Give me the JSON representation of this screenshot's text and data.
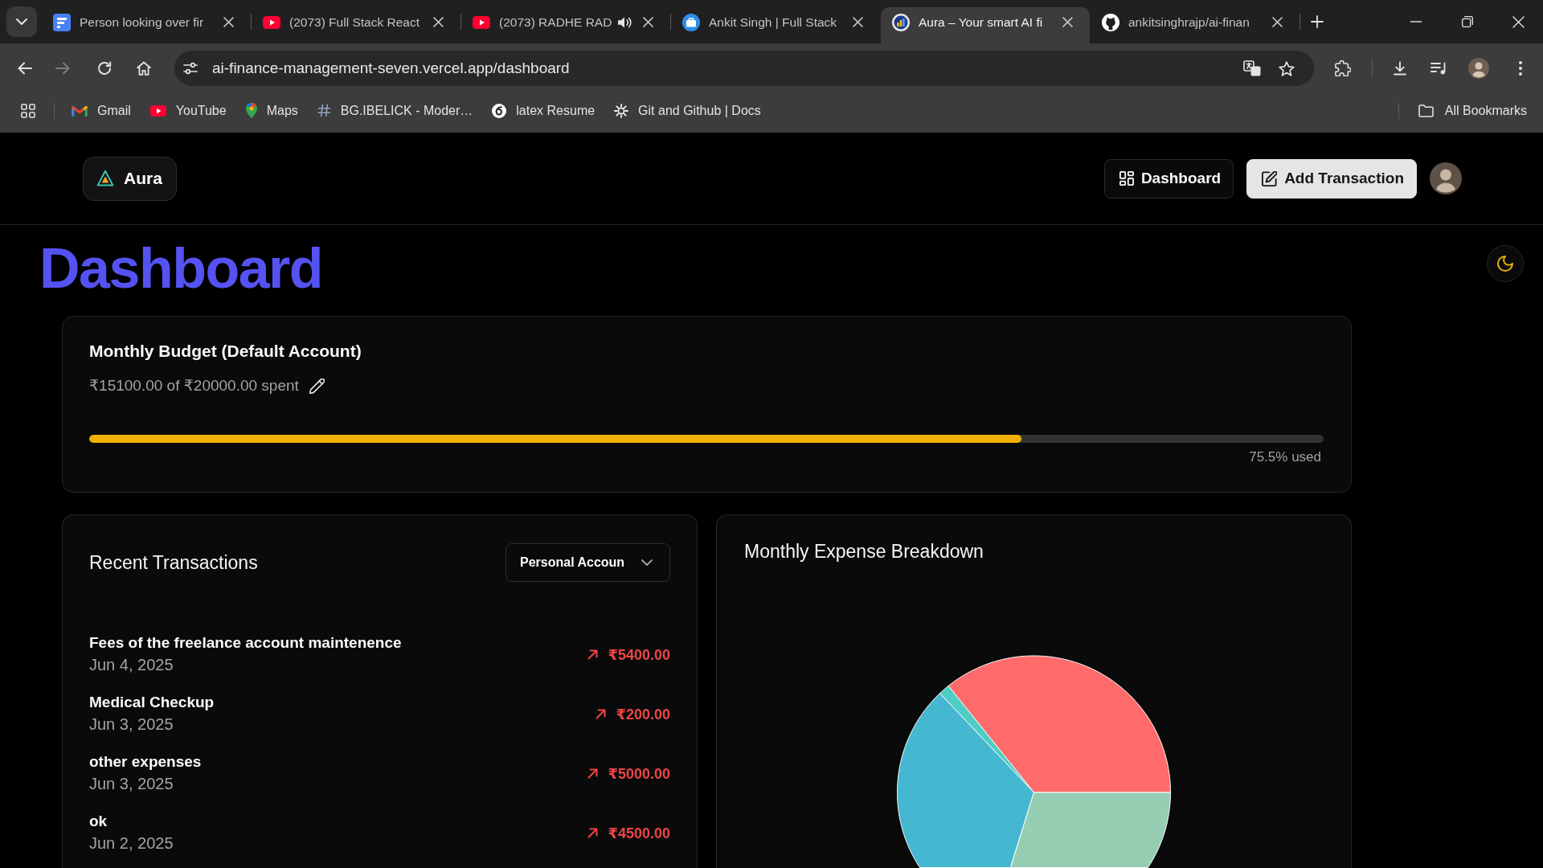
{
  "browser": {
    "tabs": [
      {
        "title": "Person looking over fir",
        "kind": "form",
        "selected": false,
        "audio": false
      },
      {
        "title": "(2073) Full Stack React",
        "kind": "video",
        "selected": false,
        "audio": false
      },
      {
        "title": "(2073) RADHE RAD",
        "kind": "video",
        "selected": false,
        "audio": true
      },
      {
        "title": "Ankit Singh | Full Stack",
        "kind": "portfolio",
        "selected": false,
        "audio": false
      },
      {
        "title": "Aura – Your smart AI fi",
        "kind": "finance",
        "selected": true,
        "audio": false
      },
      {
        "title": "ankitsinghrajp/ai-finan",
        "kind": "repository",
        "selected": false,
        "audio": false
      }
    ],
    "forward_disabled": true,
    "address": "ai-finance-management-seven.vercel.app/dashboard",
    "bookmarks": [
      {
        "label": "Gmail",
        "kind": "mail"
      },
      {
        "label": "YouTube",
        "kind": "video"
      },
      {
        "label": "Maps",
        "kind": "maps"
      },
      {
        "label": "BG.IBELICK - Moder…",
        "kind": "hash"
      },
      {
        "label": "latex Resume",
        "kind": "swirl"
      },
      {
        "label": "Git and Github | Docs",
        "kind": "sun"
      }
    ],
    "all_bookmarks": "All Bookmarks"
  },
  "app": {
    "brand": "Aura",
    "nav": [
      {
        "label": "Dashboard",
        "kind": "dashboard"
      },
      {
        "label": "Add Transaction",
        "kind": "create"
      }
    ],
    "title": "Dashboard",
    "budget": {
      "title": "Monthly Budget (Default Account)",
      "spent": "₹15100.00 of ₹20000.00 spent",
      "level": 0.755,
      "usage": "75.5% used"
    },
    "transactions": {
      "title": "Recent Transactions",
      "account": "Personal Accoun",
      "items": [
        {
          "name": "Fees of the freelance account maintenence",
          "date": "Jun 4, 2025",
          "amount": "₹5400.00",
          "kind": "expense"
        },
        {
          "name": "Medical Checkup",
          "date": "Jun 3, 2025",
          "amount": "₹200.00",
          "kind": "expense"
        },
        {
          "name": "other expenses",
          "date": "Jun 3, 2025",
          "amount": "₹5000.00",
          "kind": "expense"
        },
        {
          "name": "ok",
          "date": "Jun 2, 2025",
          "amount": "₹4500.00",
          "kind": "expense"
        }
      ]
    },
    "chart": {
      "title": "Monthly Expense Breakdown"
    }
  }
}
